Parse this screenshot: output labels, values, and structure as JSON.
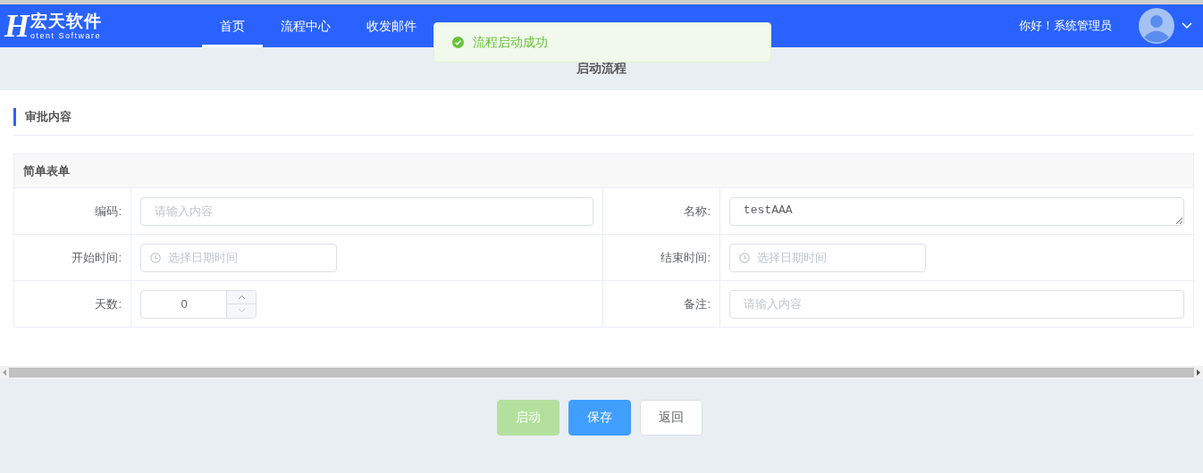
{
  "header": {
    "logo": {
      "mark": "H",
      "title": "宏天软件",
      "subtitle": "otent Software"
    },
    "nav": [
      {
        "label": "首页",
        "selected": true
      },
      {
        "label": "流程中心",
        "selected": false
      },
      {
        "label": "收发邮件",
        "selected": false
      }
    ],
    "greeting": "你好！系统管理员"
  },
  "toast": {
    "message": "流程启动成功"
  },
  "page_title": "启动流程",
  "section": {
    "title": "审批内容"
  },
  "form": {
    "title": "简单表单",
    "rows": [
      [
        {
          "label": "编码:",
          "kind": "text",
          "placeholder": "请输入内容"
        },
        {
          "label": "名称:",
          "kind": "textarea",
          "value": "testAAA"
        }
      ],
      [
        {
          "label": "开始时间:",
          "kind": "datetime",
          "placeholder": "选择日期时间"
        },
        {
          "label": "结束时间:",
          "kind": "datetime",
          "placeholder": "选择日期时间"
        }
      ],
      [
        {
          "label": "天数:",
          "kind": "number",
          "value": "0"
        },
        {
          "label": "备注:",
          "kind": "text",
          "placeholder": "请输入内容"
        }
      ]
    ]
  },
  "buttons": [
    {
      "label": "启动",
      "kind": "success",
      "disabled": true
    },
    {
      "label": "保存",
      "kind": "primary",
      "disabled": false
    },
    {
      "label": "返回",
      "kind": "default",
      "disabled": false
    }
  ]
}
